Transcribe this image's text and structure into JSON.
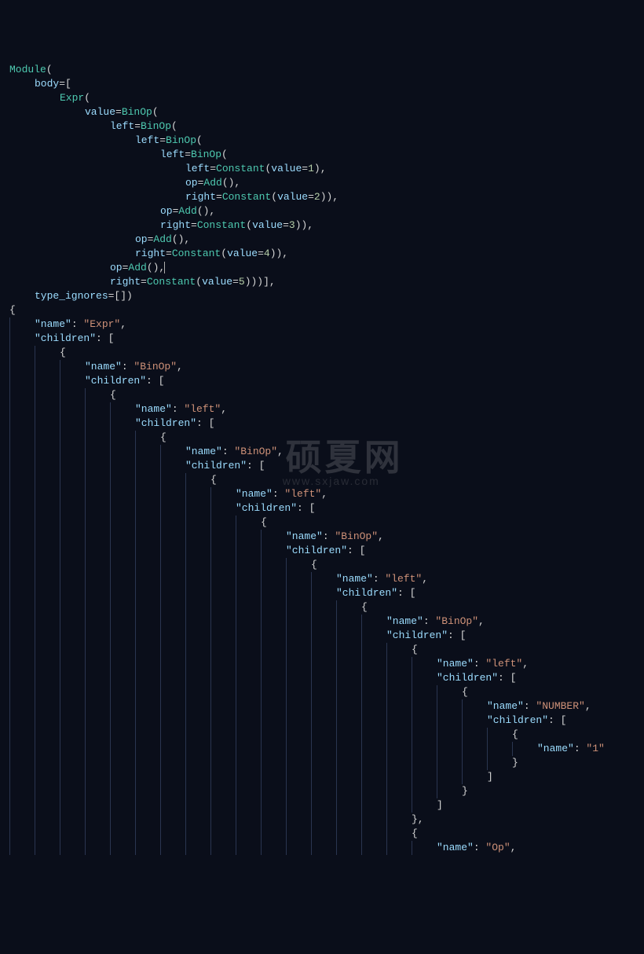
{
  "watermark": {
    "main": "硕夏网",
    "sub": "www.sxjaw.com"
  },
  "ast": [
    {
      "guides": 0,
      "indent": 0,
      "tokens": [
        {
          "t": "type",
          "v": "Module"
        },
        {
          "t": "punc",
          "v": "("
        }
      ]
    },
    {
      "guides": 0,
      "indent": 1,
      "tokens": [
        {
          "t": "field",
          "v": "body"
        },
        {
          "t": "punc",
          "v": "=["
        }
      ]
    },
    {
      "guides": 0,
      "indent": 2,
      "tokens": [
        {
          "t": "type",
          "v": "Expr"
        },
        {
          "t": "punc",
          "v": "("
        }
      ]
    },
    {
      "guides": 0,
      "indent": 3,
      "tokens": [
        {
          "t": "field",
          "v": "value"
        },
        {
          "t": "punc",
          "v": "="
        },
        {
          "t": "type",
          "v": "BinOp"
        },
        {
          "t": "punc",
          "v": "("
        }
      ]
    },
    {
      "guides": 0,
      "indent": 4,
      "tokens": [
        {
          "t": "field",
          "v": "left"
        },
        {
          "t": "punc",
          "v": "="
        },
        {
          "t": "type",
          "v": "BinOp"
        },
        {
          "t": "punc",
          "v": "("
        }
      ]
    },
    {
      "guides": 0,
      "indent": 5,
      "tokens": [
        {
          "t": "field",
          "v": "left"
        },
        {
          "t": "punc",
          "v": "="
        },
        {
          "t": "type",
          "v": "BinOp"
        },
        {
          "t": "punc",
          "v": "("
        }
      ]
    },
    {
      "guides": 0,
      "indent": 6,
      "tokens": [
        {
          "t": "field",
          "v": "left"
        },
        {
          "t": "punc",
          "v": "="
        },
        {
          "t": "type",
          "v": "BinOp"
        },
        {
          "t": "punc",
          "v": "("
        }
      ]
    },
    {
      "guides": 0,
      "indent": 7,
      "tokens": [
        {
          "t": "field",
          "v": "left"
        },
        {
          "t": "punc",
          "v": "="
        },
        {
          "t": "type",
          "v": "Constant"
        },
        {
          "t": "punc",
          "v": "("
        },
        {
          "t": "field",
          "v": "value"
        },
        {
          "t": "punc",
          "v": "="
        },
        {
          "t": "num",
          "v": "1"
        },
        {
          "t": "punc",
          "v": "),"
        }
      ]
    },
    {
      "guides": 0,
      "indent": 7,
      "tokens": [
        {
          "t": "field",
          "v": "op"
        },
        {
          "t": "punc",
          "v": "="
        },
        {
          "t": "type",
          "v": "Add"
        },
        {
          "t": "punc",
          "v": "(),"
        }
      ]
    },
    {
      "guides": 0,
      "indent": 7,
      "tokens": [
        {
          "t": "field",
          "v": "right"
        },
        {
          "t": "punc",
          "v": "="
        },
        {
          "t": "type",
          "v": "Constant"
        },
        {
          "t": "punc",
          "v": "("
        },
        {
          "t": "field",
          "v": "value"
        },
        {
          "t": "punc",
          "v": "="
        },
        {
          "t": "num",
          "v": "2"
        },
        {
          "t": "punc",
          "v": ")),"
        }
      ]
    },
    {
      "guides": 0,
      "indent": 6,
      "tokens": [
        {
          "t": "field",
          "v": "op"
        },
        {
          "t": "punc",
          "v": "="
        },
        {
          "t": "type",
          "v": "Add"
        },
        {
          "t": "punc",
          "v": "(),"
        }
      ]
    },
    {
      "guides": 0,
      "indent": 6,
      "tokens": [
        {
          "t": "field",
          "v": "right"
        },
        {
          "t": "punc",
          "v": "="
        },
        {
          "t": "type",
          "v": "Constant"
        },
        {
          "t": "punc",
          "v": "("
        },
        {
          "t": "field",
          "v": "value"
        },
        {
          "t": "punc",
          "v": "="
        },
        {
          "t": "num",
          "v": "3"
        },
        {
          "t": "punc",
          "v": ")),"
        }
      ]
    },
    {
      "guides": 0,
      "indent": 5,
      "tokens": [
        {
          "t": "field",
          "v": "op"
        },
        {
          "t": "punc",
          "v": "="
        },
        {
          "t": "type",
          "v": "Add"
        },
        {
          "t": "punc",
          "v": "(),"
        }
      ]
    },
    {
      "guides": 0,
      "indent": 5,
      "tokens": [
        {
          "t": "field",
          "v": "right"
        },
        {
          "t": "punc",
          "v": "="
        },
        {
          "t": "type",
          "v": "Constant"
        },
        {
          "t": "punc",
          "v": "("
        },
        {
          "t": "field",
          "v": "value"
        },
        {
          "t": "punc",
          "v": "="
        },
        {
          "t": "num",
          "v": "4"
        },
        {
          "t": "punc",
          "v": ")),"
        }
      ]
    },
    {
      "guides": 0,
      "indent": 4,
      "tokens": [
        {
          "t": "field",
          "v": "op"
        },
        {
          "t": "punc",
          "v": "="
        },
        {
          "t": "type",
          "v": "Add"
        },
        {
          "t": "punc",
          "v": "(),"
        },
        {
          "t": "cursor",
          "v": ""
        }
      ]
    },
    {
      "guides": 0,
      "indent": 4,
      "tokens": [
        {
          "t": "field",
          "v": "right"
        },
        {
          "t": "punc",
          "v": "="
        },
        {
          "t": "type",
          "v": "Constant"
        },
        {
          "t": "punc",
          "v": "("
        },
        {
          "t": "field",
          "v": "value"
        },
        {
          "t": "punc",
          "v": "="
        },
        {
          "t": "num",
          "v": "5"
        },
        {
          "t": "punc",
          "v": ")))],"
        }
      ]
    },
    {
      "guides": 0,
      "indent": 1,
      "tokens": [
        {
          "t": "field",
          "v": "type_ignores"
        },
        {
          "t": "punc",
          "v": "=[])"
        }
      ]
    },
    {
      "guides": 0,
      "indent": 0,
      "tokens": [
        {
          "t": "punc",
          "v": "{"
        }
      ]
    },
    {
      "guides": 1,
      "indent": 1,
      "tokens": [
        {
          "t": "key",
          "v": "\"name\""
        },
        {
          "t": "punc",
          "v": ": "
        },
        {
          "t": "str",
          "v": "\"Expr\""
        },
        {
          "t": "punc",
          "v": ","
        }
      ]
    },
    {
      "guides": 1,
      "indent": 1,
      "tokens": [
        {
          "t": "key",
          "v": "\"children\""
        },
        {
          "t": "punc",
          "v": ": ["
        }
      ]
    },
    {
      "guides": 2,
      "indent": 2,
      "tokens": [
        {
          "t": "punc",
          "v": "{"
        }
      ]
    },
    {
      "guides": 3,
      "indent": 3,
      "tokens": [
        {
          "t": "key",
          "v": "\"name\""
        },
        {
          "t": "punc",
          "v": ": "
        },
        {
          "t": "str",
          "v": "\"BinOp\""
        },
        {
          "t": "punc",
          "v": ","
        }
      ]
    },
    {
      "guides": 3,
      "indent": 3,
      "tokens": [
        {
          "t": "key",
          "v": "\"children\""
        },
        {
          "t": "punc",
          "v": ": ["
        }
      ]
    },
    {
      "guides": 4,
      "indent": 4,
      "tokens": [
        {
          "t": "punc",
          "v": "{"
        }
      ]
    },
    {
      "guides": 5,
      "indent": 5,
      "tokens": [
        {
          "t": "key",
          "v": "\"name\""
        },
        {
          "t": "punc",
          "v": ": "
        },
        {
          "t": "str",
          "v": "\"left\""
        },
        {
          "t": "punc",
          "v": ","
        }
      ]
    },
    {
      "guides": 5,
      "indent": 5,
      "tokens": [
        {
          "t": "key",
          "v": "\"children\""
        },
        {
          "t": "punc",
          "v": ": ["
        }
      ]
    },
    {
      "guides": 6,
      "indent": 6,
      "tokens": [
        {
          "t": "punc",
          "v": "{"
        }
      ]
    },
    {
      "guides": 7,
      "indent": 7,
      "tokens": [
        {
          "t": "key",
          "v": "\"name\""
        },
        {
          "t": "punc",
          "v": ": "
        },
        {
          "t": "str",
          "v": "\"BinOp\""
        },
        {
          "t": "punc",
          "v": ","
        }
      ]
    },
    {
      "guides": 7,
      "indent": 7,
      "tokens": [
        {
          "t": "key",
          "v": "\"children\""
        },
        {
          "t": "punc",
          "v": ": ["
        }
      ]
    },
    {
      "guides": 8,
      "indent": 8,
      "tokens": [
        {
          "t": "punc",
          "v": "{"
        }
      ]
    },
    {
      "guides": 9,
      "indent": 9,
      "tokens": [
        {
          "t": "key",
          "v": "\"name\""
        },
        {
          "t": "punc",
          "v": ": "
        },
        {
          "t": "str",
          "v": "\"left\""
        },
        {
          "t": "punc",
          "v": ","
        }
      ]
    },
    {
      "guides": 9,
      "indent": 9,
      "tokens": [
        {
          "t": "key",
          "v": "\"children\""
        },
        {
          "t": "punc",
          "v": ": ["
        }
      ]
    },
    {
      "guides": 10,
      "indent": 10,
      "tokens": [
        {
          "t": "punc",
          "v": "{"
        }
      ]
    },
    {
      "guides": 11,
      "indent": 11,
      "tokens": [
        {
          "t": "key",
          "v": "\"name\""
        },
        {
          "t": "punc",
          "v": ": "
        },
        {
          "t": "str",
          "v": "\"BinOp\""
        },
        {
          "t": "punc",
          "v": ","
        }
      ]
    },
    {
      "guides": 11,
      "indent": 11,
      "tokens": [
        {
          "t": "key",
          "v": "\"children\""
        },
        {
          "t": "punc",
          "v": ": ["
        }
      ]
    },
    {
      "guides": 12,
      "indent": 12,
      "tokens": [
        {
          "t": "punc",
          "v": "{"
        }
      ]
    },
    {
      "guides": 13,
      "indent": 13,
      "tokens": [
        {
          "t": "key",
          "v": "\"name\""
        },
        {
          "t": "punc",
          "v": ": "
        },
        {
          "t": "str",
          "v": "\"left\""
        },
        {
          "t": "punc",
          "v": ","
        }
      ]
    },
    {
      "guides": 13,
      "indent": 13,
      "tokens": [
        {
          "t": "key",
          "v": "\"children\""
        },
        {
          "t": "punc",
          "v": ": ["
        }
      ]
    },
    {
      "guides": 14,
      "indent": 14,
      "tokens": [
        {
          "t": "punc",
          "v": "{"
        }
      ]
    },
    {
      "guides": 15,
      "indent": 15,
      "tokens": [
        {
          "t": "key",
          "v": "\"name\""
        },
        {
          "t": "punc",
          "v": ": "
        },
        {
          "t": "str",
          "v": "\"BinOp\""
        },
        {
          "t": "punc",
          "v": ","
        }
      ]
    },
    {
      "guides": 15,
      "indent": 15,
      "tokens": [
        {
          "t": "key",
          "v": "\"children\""
        },
        {
          "t": "punc",
          "v": ": ["
        }
      ]
    },
    {
      "guides": 16,
      "indent": 16,
      "tokens": [
        {
          "t": "punc",
          "v": "{"
        }
      ]
    },
    {
      "guides": 17,
      "indent": 17,
      "tokens": [
        {
          "t": "key",
          "v": "\"name\""
        },
        {
          "t": "punc",
          "v": ": "
        },
        {
          "t": "str",
          "v": "\"left\""
        },
        {
          "t": "punc",
          "v": ","
        }
      ]
    },
    {
      "guides": 17,
      "indent": 17,
      "tokens": [
        {
          "t": "key",
          "v": "\"children\""
        },
        {
          "t": "punc",
          "v": ": ["
        }
      ]
    },
    {
      "guides": 18,
      "indent": 18,
      "tokens": [
        {
          "t": "punc",
          "v": "{"
        }
      ]
    },
    {
      "guides": 19,
      "indent": 19,
      "tokens": [
        {
          "t": "key",
          "v": "\"name\""
        },
        {
          "t": "punc",
          "v": ": "
        },
        {
          "t": "str",
          "v": "\"NUMBER\""
        },
        {
          "t": "punc",
          "v": ","
        }
      ]
    },
    {
      "guides": 19,
      "indent": 19,
      "tokens": [
        {
          "t": "key",
          "v": "\"children\""
        },
        {
          "t": "punc",
          "v": ": ["
        }
      ]
    },
    {
      "guides": 20,
      "indent": 20,
      "tokens": [
        {
          "t": "punc",
          "v": "{"
        }
      ]
    },
    {
      "guides": 21,
      "indent": 21,
      "tokens": [
        {
          "t": "key",
          "v": "\"name\""
        },
        {
          "t": "punc",
          "v": ": "
        },
        {
          "t": "str",
          "v": "\"1\""
        }
      ]
    },
    {
      "guides": 20,
      "indent": 20,
      "tokens": [
        {
          "t": "punc",
          "v": "}"
        }
      ]
    },
    {
      "guides": 19,
      "indent": 19,
      "tokens": [
        {
          "t": "punc",
          "v": "]"
        }
      ]
    },
    {
      "guides": 18,
      "indent": 18,
      "tokens": [
        {
          "t": "punc",
          "v": "}"
        }
      ]
    },
    {
      "guides": 17,
      "indent": 17,
      "tokens": [
        {
          "t": "punc",
          "v": "]"
        }
      ]
    },
    {
      "guides": 16,
      "indent": 16,
      "tokens": [
        {
          "t": "punc",
          "v": "},"
        }
      ]
    },
    {
      "guides": 16,
      "indent": 16,
      "tokens": [
        {
          "t": "punc",
          "v": "{"
        }
      ]
    },
    {
      "guides": 17,
      "indent": 17,
      "tokens": [
        {
          "t": "key",
          "v": "\"name\""
        },
        {
          "t": "punc",
          "v": ": "
        },
        {
          "t": "str",
          "v": "\"Op\""
        },
        {
          "t": "punc",
          "v": ","
        }
      ]
    }
  ]
}
